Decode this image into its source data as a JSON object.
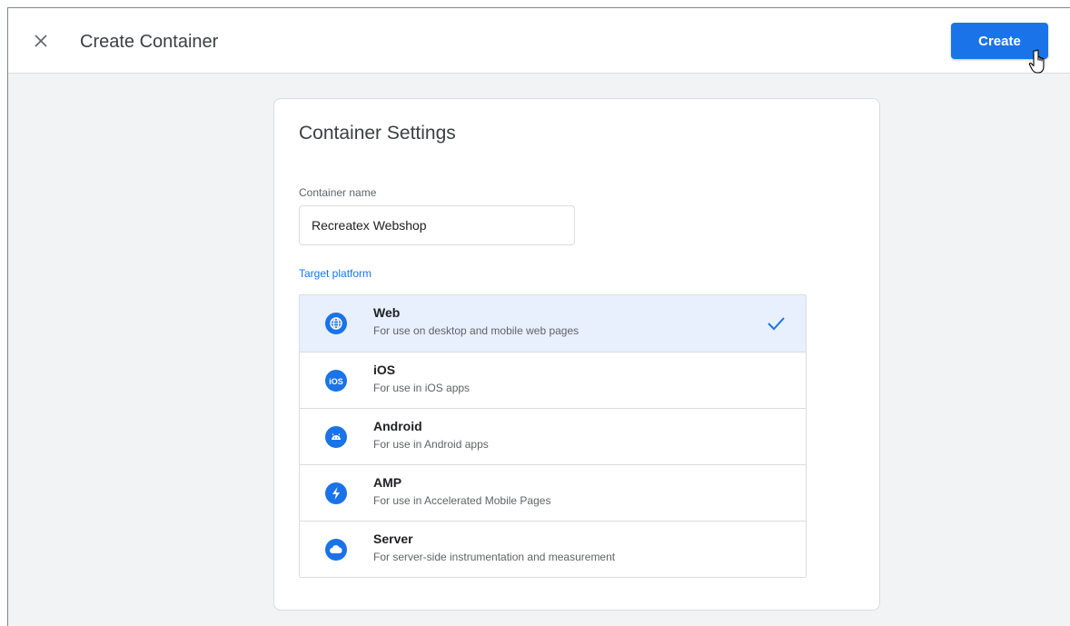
{
  "header": {
    "title": "Create Container",
    "create_label": "Create"
  },
  "card": {
    "title": "Container Settings",
    "name_label": "Container name",
    "name_value": "Recreatex Webshop",
    "platform_label": "Target platform"
  },
  "platforms": [
    {
      "name": "Web",
      "description": "For use on desktop and mobile web pages",
      "icon": "globe-icon",
      "selected": true
    },
    {
      "name": "iOS",
      "description": "For use in iOS apps",
      "icon": "ios-icon",
      "selected": false
    },
    {
      "name": "Android",
      "description": "For use in Android apps",
      "icon": "android-icon",
      "selected": false
    },
    {
      "name": "AMP",
      "description": "For use in Accelerated Mobile Pages",
      "icon": "lightning-icon",
      "selected": false
    },
    {
      "name": "Server",
      "description": "For server-side instrumentation and measurement",
      "icon": "cloud-icon",
      "selected": false
    }
  ],
  "colors": {
    "accent": "#1a73e8",
    "selected_bg": "#e8f0fe",
    "border": "#dadce0"
  }
}
